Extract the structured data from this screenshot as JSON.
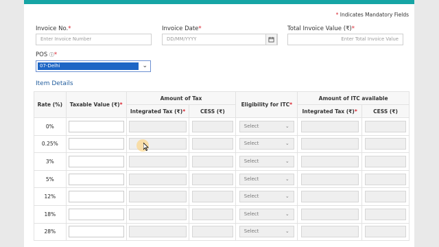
{
  "header": {
    "mandatory_note": "Indicates Mandatory Fields",
    "asterisk": "*"
  },
  "form": {
    "invoice_no": {
      "label": "Invoice No.",
      "placeholder": "Enter Invoice Number"
    },
    "invoice_date": {
      "label": "Invoice Date",
      "placeholder": "DD/MM/YYYY"
    },
    "total_value": {
      "label": "Total Invoice Value (₹)",
      "placeholder": "Enter Total Invoice Value"
    },
    "pos": {
      "label": "POS",
      "info_icon": "ⓘ",
      "value": "07-Delhi"
    }
  },
  "items": {
    "title": "Item Details",
    "headers": {
      "rate": "Rate (%)",
      "taxable_value": "Taxable Value (₹)",
      "amount_of_tax": "Amount of Tax",
      "eligibility": "Eligibility for ITC",
      "amount_itc": "Amount of ITC available",
      "integrated_tax": "Integrated Tax (₹)",
      "cess": "CESS (₹)"
    },
    "select_label": "Select",
    "rows": [
      {
        "rate": "0%"
      },
      {
        "rate": "0.25%"
      },
      {
        "rate": "3%"
      },
      {
        "rate": "5%"
      },
      {
        "rate": "12%"
      },
      {
        "rate": "18%"
      },
      {
        "rate": "28%"
      }
    ]
  },
  "colors": {
    "accent": "#16a5a5",
    "required": "#d9232e",
    "link": "#1f5b9c",
    "selection": "#1e66c5"
  },
  "icons": {
    "calendar": "calendar-icon",
    "chevron": "chevron-down-icon",
    "info": "info-icon",
    "cursor": "mouse-cursor-icon"
  }
}
